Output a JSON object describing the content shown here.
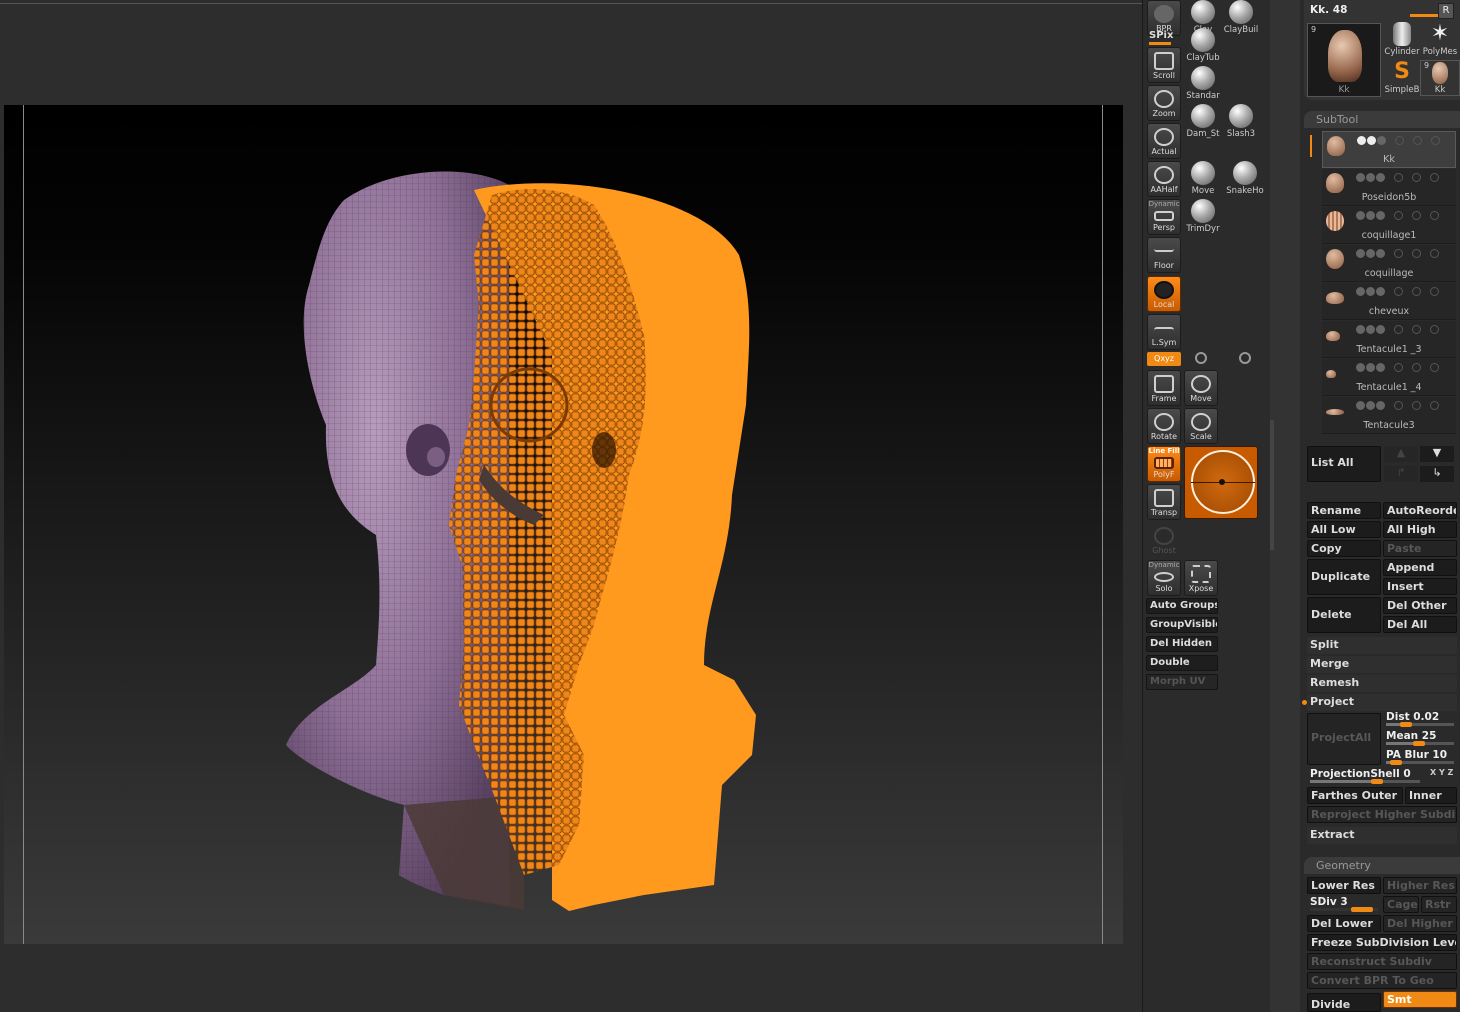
{
  "shelf": {
    "bpr": "BPR",
    "spix": "SPix",
    "scroll": "Scroll",
    "zoom": "Zoom",
    "actual": "Actual",
    "aahalf": "AAHalf",
    "dynamic_persp": "Dynamic",
    "persp": "Persp",
    "floor": "Floor",
    "local": "Local",
    "lsym": "L.Sym",
    "xyz": "Qxyz",
    "frame": "Frame",
    "move": "Move",
    "rotate": "Rotate",
    "scale": "Scale",
    "line_fill": "Line Fill",
    "polyf": "PolyF",
    "transp": "Transp",
    "ghost": "Ghost",
    "dynamic_solo": "Dynamic",
    "solo": "Solo",
    "xpose": "Xpose"
  },
  "brushes": [
    "Clay",
    "ClayBuil",
    "ClayTub",
    "Standar",
    "Dam_St",
    "Slash3",
    "Move",
    "SnakeHo",
    "TrimDyr"
  ],
  "groups": {
    "auto_groups": "Auto Groups",
    "group_visible": "GroupVisible",
    "del_hidden": "Del Hidden",
    "double": "Double",
    "morph_uv": "Morph UV"
  },
  "tool": {
    "name": "Kk. 48",
    "r_button": "R",
    "count_badge": "9",
    "thumb_label": "Kk",
    "items": [
      "Cylinder",
      "PolyMes",
      "SimpleB",
      "Kk"
    ],
    "kk_badge": "9"
  },
  "subtool": {
    "title": "SubTool",
    "items": [
      "Kk",
      "Poseidon5b",
      "coquillage1",
      "coquillage",
      "cheveux",
      "Tentacule1 _3",
      "Tentacule1 _4",
      "Tentacule3"
    ],
    "list_all": "List All",
    "rename": "Rename",
    "autoreorder": "AutoReorde",
    "all_low": "All Low",
    "all_high": "All High",
    "copy": "Copy",
    "paste": "Paste",
    "duplicate": "Duplicate",
    "append": "Append",
    "insert": "Insert",
    "delete": "Delete",
    "del_other": "Del Other",
    "del_all": "Del All",
    "split": "Split",
    "merge": "Merge",
    "remesh": "Remesh",
    "project": "Project",
    "project_all": "ProjectAll",
    "dist": "Dist 0.02",
    "mean": "Mean 25",
    "pa_blur": "PA Blur 10",
    "projection_shell": "ProjectionShell 0",
    "xyz_label": "X Y Z",
    "farthest": "Farthes",
    "outer": "Outer",
    "inner": "Inner",
    "reproject": "Reproject Higher Subdiv",
    "extract": "Extract"
  },
  "geometry": {
    "title": "Geometry",
    "lower_res": "Lower Res",
    "higher_res": "Higher Res",
    "sdiv": "SDiv 3",
    "cage": "Cage",
    "rstr": "Rstr",
    "del_lower": "Del Lower",
    "del_higher": "Del Higher",
    "freeze": "Freeze SubDivision Levels",
    "reconstruct": "Reconstruct Subdiv",
    "convert_bpr": "Convert BPR To Geo",
    "divide": "Divide",
    "smt": "Smt"
  },
  "colors": {
    "accent": "#f08a14",
    "mesh_purple": "#8e6f96",
    "mesh_orange": "#ff9a1f"
  }
}
